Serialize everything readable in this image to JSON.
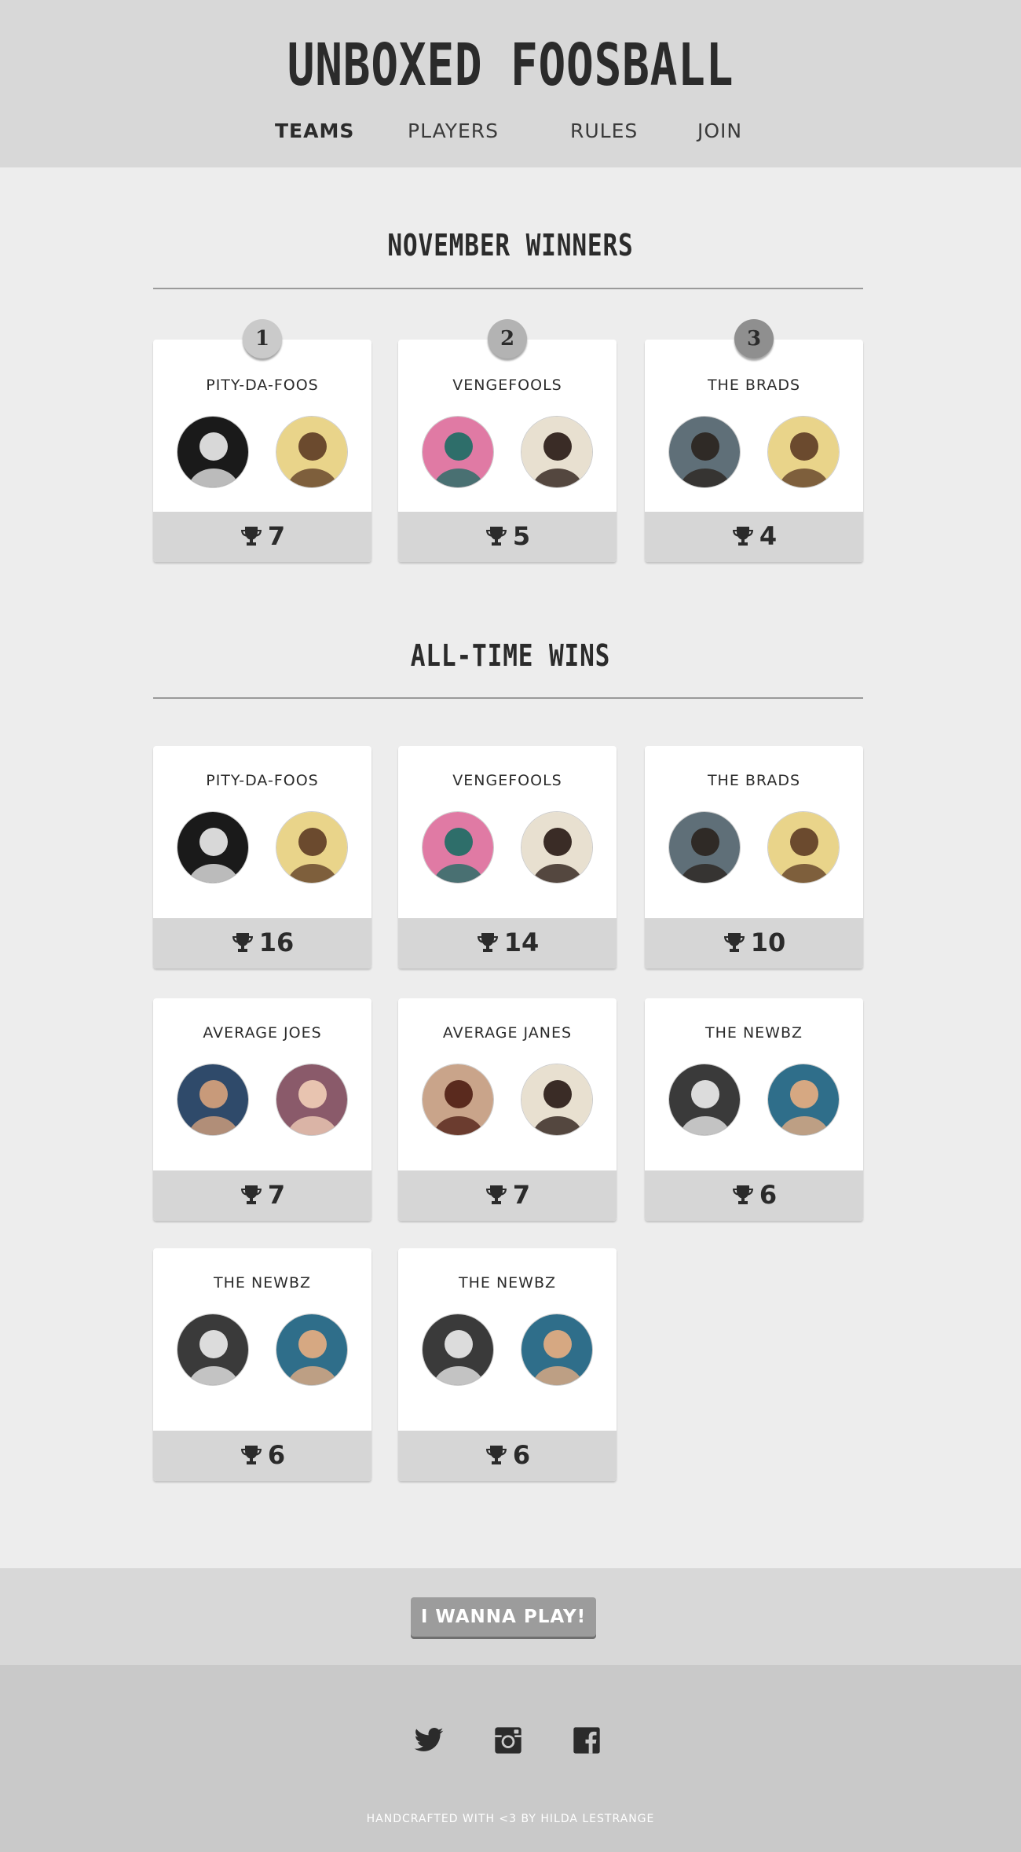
{
  "header": {
    "title": "UNBOXED FOOSBALL",
    "nav": [
      {
        "label": "TEAMS",
        "active": true
      },
      {
        "label": "PLAYERS",
        "active": false
      },
      {
        "label": "RULES",
        "active": false
      },
      {
        "label": "JOIN",
        "active": false
      }
    ]
  },
  "monthly": {
    "title": "NOVEMBER WINNERS",
    "teams": [
      {
        "rank": "1",
        "name": "PITY-DA-FOOS",
        "wins": "7"
      },
      {
        "rank": "2",
        "name": "VENGEFOOLS",
        "wins": "5"
      },
      {
        "rank": "3",
        "name": "THE BRADS",
        "wins": "4"
      }
    ]
  },
  "alltime": {
    "title": "ALL-TIME WINS",
    "teams": [
      {
        "name": "PITY-DA-FOOS",
        "wins": "16"
      },
      {
        "name": "VENGEFOOLS",
        "wins": "14"
      },
      {
        "name": "THE BRADS",
        "wins": "10"
      },
      {
        "name": "AVERAGE JOES",
        "wins": "7"
      },
      {
        "name": "AVERAGE JANES",
        "wins": "7"
      },
      {
        "name": "THE NEWBZ",
        "wins": "6"
      },
      {
        "name": "THE NEWBZ",
        "wins": "6"
      },
      {
        "name": "THE NEWBZ",
        "wins": "6"
      }
    ]
  },
  "cta": {
    "label": "I WANNA PLAY!"
  },
  "footer": {
    "social": [
      "twitter-icon",
      "instagram-icon",
      "facebook-icon"
    ],
    "credit": "HANDCRAFTED WITH <3 BY HILDA LESTRANGE"
  },
  "colors": {
    "background": "#ededed",
    "header": "#d8d8d8",
    "card_foot": "#d6d6d6",
    "footer": "#c9c9c9",
    "button": "#9c9c9c",
    "text": "#2b2b2b"
  }
}
